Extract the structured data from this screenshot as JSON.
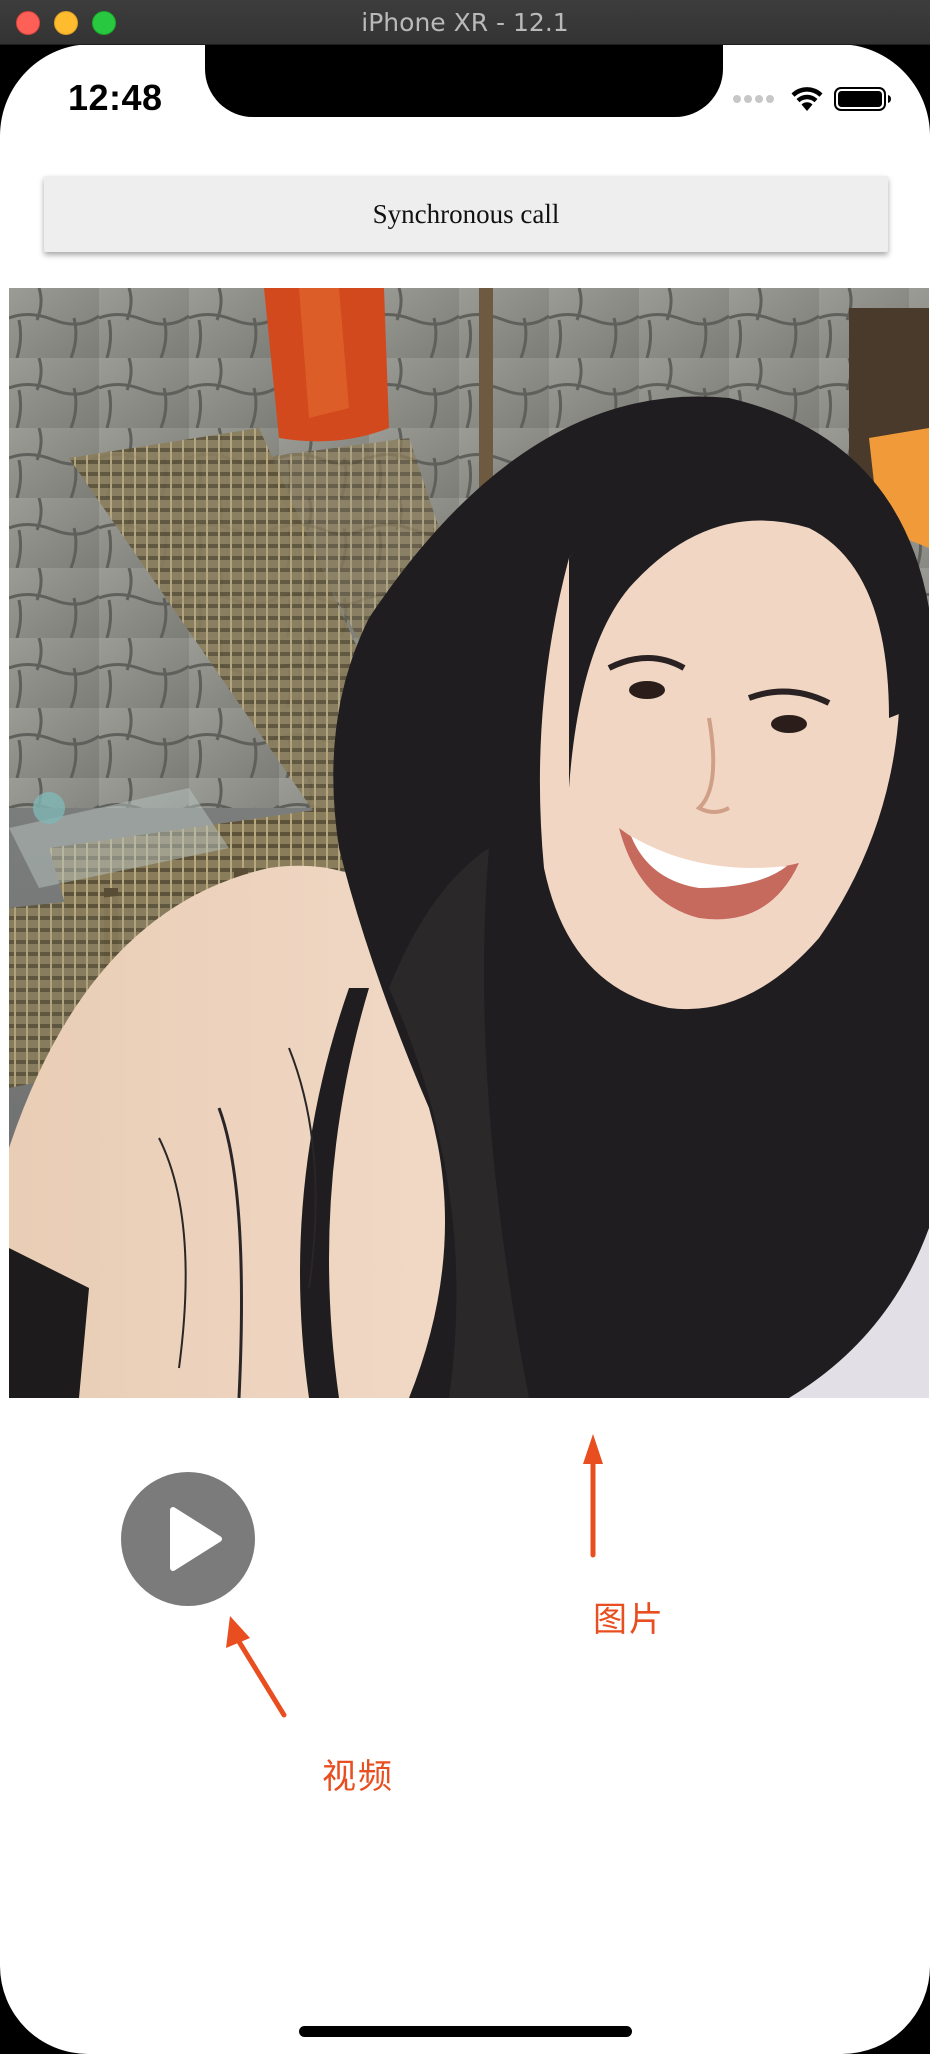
{
  "window": {
    "title": "iPhone XR - 12.1"
  },
  "status_bar": {
    "time": "12:48",
    "icons": [
      "cellular-signal-icon",
      "wifi-icon",
      "battery-icon"
    ]
  },
  "sync_button": {
    "label": "Synchronous call"
  },
  "photo": {
    "description_icon": "photo-image"
  },
  "video": {
    "icon": "play-icon"
  },
  "annotations": {
    "image_label": "图片",
    "video_label": "视频",
    "color": "#e84e1f"
  },
  "colors": {
    "accent": "#e84e1f",
    "button_bg": "#eeeeee",
    "play_bg": "#7b7b7b"
  }
}
